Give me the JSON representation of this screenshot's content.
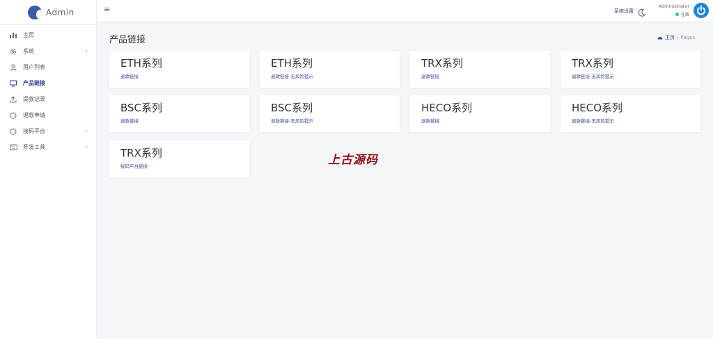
{
  "brand": {
    "name": "Admin",
    "logo_icon": "planet-logo-icon"
  },
  "sidebar": {
    "items": [
      {
        "label": "主页",
        "icon": "bar-chart-icon",
        "arrow": false,
        "active": false
      },
      {
        "label": "系统",
        "icon": "gear-icon",
        "arrow": true,
        "active": false
      },
      {
        "label": "用户列表",
        "icon": "user-icon",
        "arrow": false,
        "active": false
      },
      {
        "label": "产品链接",
        "icon": "monitor-icon",
        "arrow": false,
        "active": true
      },
      {
        "label": "提款记录",
        "icon": "upload-icon",
        "arrow": false,
        "active": false
      },
      {
        "label": "退款申请",
        "icon": "circle-icon",
        "arrow": false,
        "active": false
      },
      {
        "label": "接码平台",
        "icon": "circle-icon",
        "arrow": true,
        "active": false
      },
      {
        "label": "开发工具",
        "icon": "keyboard-icon",
        "arrow": true,
        "active": false
      }
    ]
  },
  "topbar": {
    "settings_label": "系统设置",
    "user_name": "Administrator",
    "user_status": "在线",
    "status_color": "#2ecc71",
    "avatar_color": "#1a88d6"
  },
  "main": {
    "title": "产品链接",
    "breadcrumb": {
      "home": "主页",
      "sep": "/",
      "current": "Pages"
    }
  },
  "cards": [
    {
      "title": "ETH系列",
      "sub": "退款链接"
    },
    {
      "title": "ETH系列",
      "sub": "退款链接-无风险提示"
    },
    {
      "title": "TRX系列",
      "sub": "退款链接"
    },
    {
      "title": "TRX系列",
      "sub": "退款链接-无风险提示"
    },
    {
      "title": "BSC系列",
      "sub": "退款链接"
    },
    {
      "title": "BSC系列",
      "sub": "退款链接-无风险提示"
    },
    {
      "title": "HECO系列",
      "sub": "退款链接"
    },
    {
      "title": "HECO系列",
      "sub": "退款链接-无风险提示"
    },
    {
      "title": "TRX系列",
      "sub": "接码平台链接"
    }
  ],
  "watermark": "上古源码"
}
